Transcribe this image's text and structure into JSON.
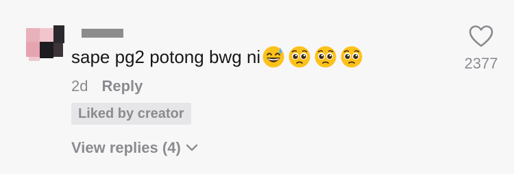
{
  "comment": {
    "text": "sape pg2 potong bwg ni",
    "emojis": [
      "grinning-face-with-sweat",
      "pleading-face",
      "pleading-face",
      "pleading-face"
    ],
    "time": "2d",
    "reply_label": "Reply",
    "badge": "Liked by creator",
    "view_replies": "View replies (4)",
    "like_count": "2377"
  },
  "colors": {
    "background": "#f8f7f8",
    "text": "#171717",
    "muted": "#8a8a8f",
    "badge_bg": "#e6e6e8"
  },
  "icons": {
    "like": "heart-outline-icon",
    "expand": "chevron-down-icon"
  }
}
